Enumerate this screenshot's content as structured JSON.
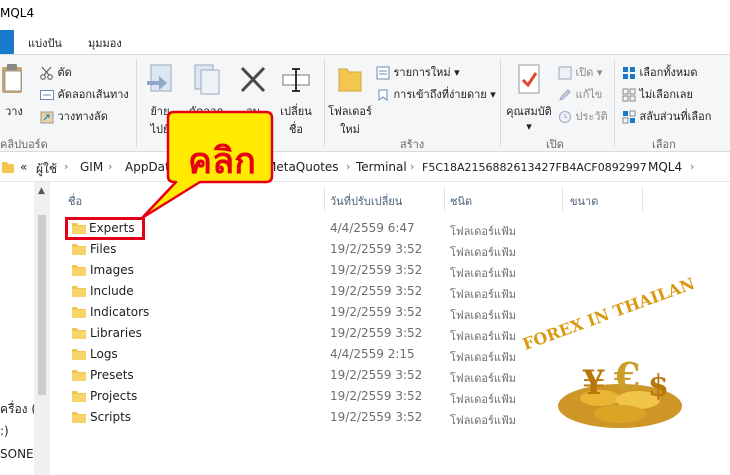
{
  "window": {
    "title": "MQL4"
  },
  "ribbon_tabs": [
    "แบ่งปัน",
    "มุมมอง"
  ],
  "ribbon": {
    "clipboard": {
      "paste_label": "วาง",
      "cut_label": "ตัด",
      "copy_path_label": "คัดลอกเส้นทาง",
      "paste_shortcut_label": "วางทางลัด",
      "group_label": "คลิปบอร์ด"
    },
    "organize": {
      "move_to_label": [
        "ย้าย",
        "ไปยั"
      ],
      "copy_to_label": "คัดลอก",
      "delete_label": "ลบ",
      "rename_label": [
        "เปลี่ยน",
        "ชื่อ"
      ]
    },
    "new": {
      "new_folder_label": [
        "โฟลเดอร์",
        "ใหม่"
      ],
      "new_item_label": "รายการใหม่",
      "easy_access_label": "การเข้าถึงที่ง่ายดาย",
      "group_label": "สร้าง"
    },
    "open": {
      "properties_label": "คุณสมบัติ",
      "open_label": "เปิด",
      "edit_label": "แก้ไข",
      "history_label": "ประวัติ",
      "group_label": "เปิด"
    },
    "select": {
      "select_all_label": "เลือกทั้งหมด",
      "select_none_label": "ไม่เลือกเลย",
      "invert_label": "สลับส่วนที่เลือก",
      "group_label": "เลือก"
    }
  },
  "address": {
    "overflow": "«",
    "crumbs": [
      "ผู้ใช้",
      "GIM",
      "AppData",
      "MetaQuotes",
      "Terminal",
      "F5C18A2156882613427FB4ACF0892997",
      "MQL4"
    ]
  },
  "nav_pane": {
    "items": [
      "ครื่อง (C",
      ":)",
      "SONE"
    ]
  },
  "columns": {
    "name": "ชื่อ",
    "date": "วันที่ปรับเปลี่ยน",
    "type": "ชนิด",
    "size": "ขนาด"
  },
  "files": [
    {
      "name": "Experts",
      "date": "4/4/2559 6:47",
      "type": "โฟลเดอร์แฟ้ม"
    },
    {
      "name": "Files",
      "date": "19/2/2559 3:52",
      "type": "โฟลเดอร์แฟ้ม"
    },
    {
      "name": "Images",
      "date": "19/2/2559 3:52",
      "type": "โฟลเดอร์แฟ้ม"
    },
    {
      "name": "Include",
      "date": "19/2/2559 3:52",
      "type": "โฟลเดอร์แฟ้ม"
    },
    {
      "name": "Indicators",
      "date": "19/2/2559 3:52",
      "type": "โฟลเดอร์แฟ้ม"
    },
    {
      "name": "Libraries",
      "date": "19/2/2559 3:52",
      "type": "โฟลเดอร์แฟ้ม"
    },
    {
      "name": "Logs",
      "date": "4/4/2559 2:15",
      "type": "โฟลเดอร์แฟ้ม"
    },
    {
      "name": "Presets",
      "date": "19/2/2559 3:52",
      "type": "โฟลเดอร์แฟ้ม"
    },
    {
      "name": "Projects",
      "date": "19/2/2559 3:52",
      "type": "โฟลเดอร์แฟ้ม"
    },
    {
      "name": "Scripts",
      "date": "19/2/2559 3:52",
      "type": "โฟลเดอร์แฟ้ม"
    }
  ],
  "callout": {
    "text": "คลิก"
  },
  "watermark": {
    "text": "FOREX IN THAILAN"
  },
  "colors": {
    "accent": "#1979ca",
    "highlight": "#e4001b",
    "callout_fill": "#ffea00",
    "folder": "#f3c74f"
  }
}
